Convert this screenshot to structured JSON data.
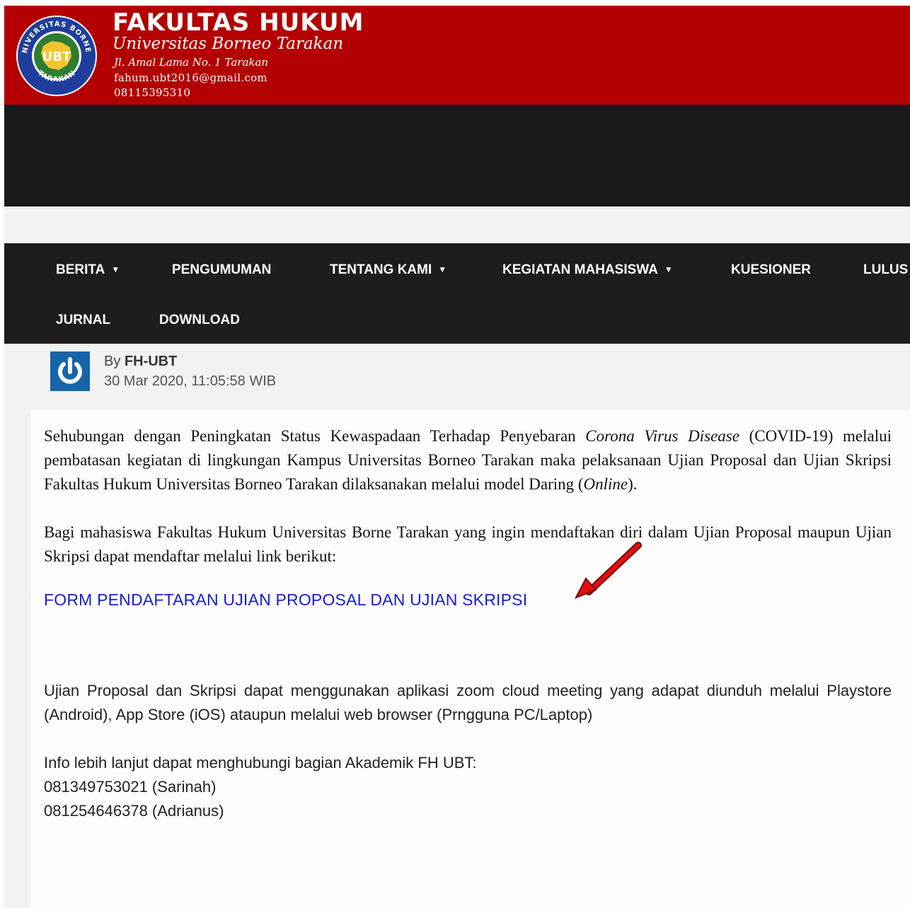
{
  "header": {
    "title": "FAKULTAS HUKUM",
    "university": "Universitas Borneo Tarakan",
    "address": "Jl. Amal Lama No. 1 Tarakan",
    "email": "fahum.ubt2016@gmail.com",
    "phone": "08115395310",
    "logo": {
      "top_text": "UNIVERSITAS BORNEO",
      "bottom_text": "TARAKAN",
      "center_text": "UBT"
    }
  },
  "nav": {
    "items": [
      {
        "label": "BERITA",
        "has_dropdown": true
      },
      {
        "label": "PENGUMUMAN",
        "has_dropdown": false
      },
      {
        "label": "TENTANG KAMI",
        "has_dropdown": true
      },
      {
        "label": "KEGIATAN MAHASISWA",
        "has_dropdown": true
      },
      {
        "label": "KUESIONER",
        "has_dropdown": false
      },
      {
        "label": "LULUS",
        "has_dropdown": false
      },
      {
        "label": "JURNAL",
        "has_dropdown": false
      },
      {
        "label": "DOWNLOAD",
        "has_dropdown": false
      }
    ],
    "dropdown_caret": "▼"
  },
  "post": {
    "by_prefix": "By ",
    "author": "FH-UBT",
    "date": "30 Mar 2020, 11:05:58 WIB",
    "paragraph1": {
      "part1": "Sehubungan dengan Peningkatan Status Kewaspadaan Terhadap Penyebaran ",
      "italic1": "Corona Virus Disease",
      "part2": " (COVID-19) melalui pembatasan kegiatan di lingkungan Kampus Universitas Borneo Tarakan maka pelaksanaan Ujian Proposal dan Ujian Skripsi Fakultas Hukum Universitas Borneo Tarakan dilaksanakan melalui model Daring (",
      "italic2": "Online",
      "part3": ")."
    },
    "paragraph2": "Bagi mahasiswa Fakultas Hukum Universitas Borne Tarakan yang ingin mendaftakan diri dalam Ujian Proposal maupun Ujian Skripsi dapat mendaftar melalui link berikut:",
    "link_label": "FORM PENDAFTARAN UJIAN PROPOSAL DAN UJIAN SKRIPSI",
    "paragraph3": "Ujian Proposal dan Skripsi dapat menggunakan aplikasi zoom cloud meeting yang adapat diunduh melalui Playstore (Android), App Store (iOS) ataupun melalui web browser (Prngguna PC/Laptop)",
    "contact_intro": "Info lebih lanjut dapat menghubungi bagian Akademik FH UBT:",
    "contact1": "081349753021 (Sarinah)",
    "contact2": "081254646378 (Adrianus)"
  },
  "colors": {
    "banner": "#b30000",
    "nav_bg": "#1d1d1d",
    "link": "#1a1ad6",
    "annotation_arrow": "#e01010",
    "avatar": "#1565a8"
  },
  "icons": {
    "avatar": "power-icon",
    "annotation": "red-arrow-icon"
  }
}
